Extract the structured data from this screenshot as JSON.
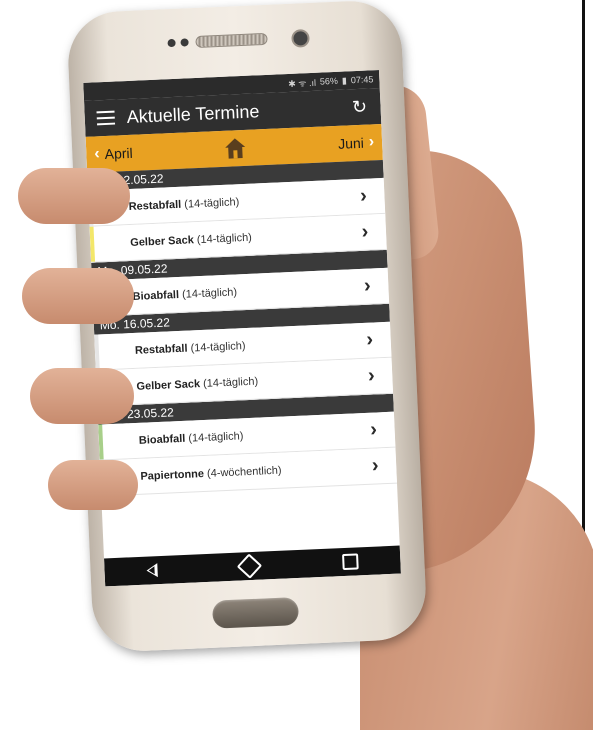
{
  "status_bar": {
    "icons": "✱ ᯤ .ıl",
    "battery": "56%",
    "time": "07:45"
  },
  "app_bar": {
    "title": "Aktuelle Termine",
    "menu_icon": "hamburger-menu-icon",
    "refresh_icon": "refresh-icon"
  },
  "month_nav": {
    "prev_label": "April",
    "next_label": "Juni",
    "home_icon": "house-icon"
  },
  "dates": [
    {
      "date": "Mo. 02.05.22",
      "items": [
        {
          "name": "Restabfall",
          "interval": "(14-täglich)",
          "color": "#e6e6e6"
        },
        {
          "name": "Gelber Sack",
          "interval": "(14-täglich)",
          "color": "#f3e76a"
        }
      ]
    },
    {
      "date": "Mo. 09.05.22",
      "items": [
        {
          "name": "Bioabfall",
          "interval": "(14-täglich)",
          "color": "#a8cf8a"
        }
      ]
    },
    {
      "date": "Mo. 16.05.22",
      "items": [
        {
          "name": "Restabfall",
          "interval": "(14-täglich)",
          "color": "#e6e6e6"
        },
        {
          "name": "Gelber Sack",
          "interval": "(14-täglich)",
          "color": "#f3e76a"
        }
      ]
    },
    {
      "date": "Mo. 23.05.22",
      "items": [
        {
          "name": "Bioabfall",
          "interval": "(14-täglich)",
          "color": "#a8cf8a"
        },
        {
          "name": "Papiertonne",
          "interval": "(4-wöchentlich)",
          "color": "#8ab7e4"
        }
      ]
    }
  ],
  "colors": {
    "accent": "#e8a122",
    "appbar": "#2f2f2f",
    "header": "#3a3a3a"
  }
}
